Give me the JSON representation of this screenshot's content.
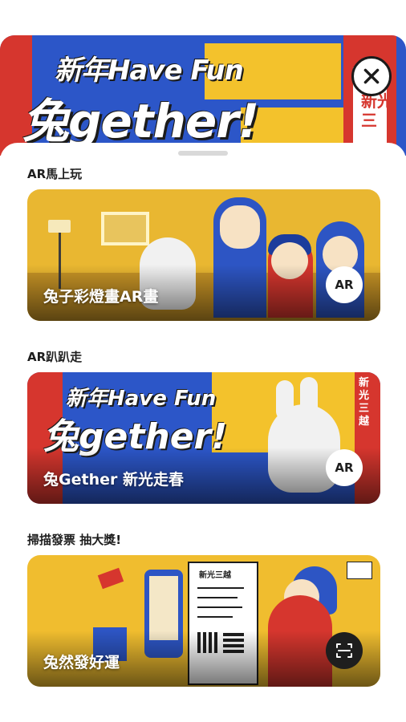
{
  "hero": {
    "title_line1": "新年Have Fun",
    "title_line2": "兔gether!",
    "sign_text": "新光三"
  },
  "close_button": {
    "icon": "close-icon"
  },
  "sections": [
    {
      "label": "AR馬上玩",
      "caption": "兔子彩燈畫AR畫",
      "badge": "AR"
    },
    {
      "label": "AR趴趴走",
      "caption": "兔Gether 新光走春",
      "badge": "AR",
      "art_title_line1": "新年Have Fun",
      "art_title_line2": "兔gether!",
      "art_sign": "新光三越"
    },
    {
      "label": "掃描發票 抽大獎!",
      "caption": "兔然發好運",
      "badge_icon": "scan-icon",
      "receipt_title": "新光三越"
    }
  ],
  "colors": {
    "blue": "#2c56c8",
    "yellow": "#f3c22c",
    "red": "#d6362e"
  }
}
